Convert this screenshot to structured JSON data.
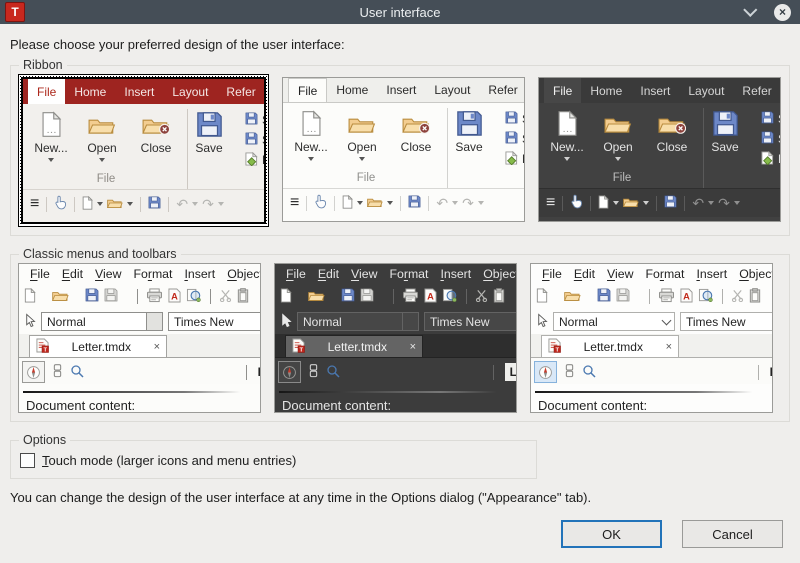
{
  "window": {
    "title": "User interface",
    "app_icon": "T",
    "controls": {
      "close": "×"
    }
  },
  "colors": {
    "titlebar": "#454e57",
    "dialog_bg": "#efeeec",
    "ribbon_red": "#9e2420",
    "ok_button_border": "#2273b9",
    "folder_icon": "#f3cd90",
    "floppy_icon": "#6d88c8"
  },
  "intro": "Please choose your preferred design of the user interface:",
  "selection": {
    "selected_preview": "ribbon-colorful"
  },
  "ribbon_group": {
    "label": "Ribbon"
  },
  "classic_group": {
    "label": "Classic menus and toolbars"
  },
  "options_group": {
    "label": "Options",
    "touch_mode": {
      "accel": "T",
      "rest": "ouch mode (larger icons and menu entries)",
      "checked": false
    }
  },
  "ribbon_preview": {
    "tabs": [
      "File",
      "Home",
      "Insert",
      "Layout",
      "Refer"
    ],
    "active_tab": "File",
    "big_buttons": [
      "New...",
      "Open",
      "Close",
      "Save"
    ],
    "small_buttons": [
      "Sa",
      "Sa",
      "EP"
    ],
    "group_label": "File"
  },
  "classic_preview": {
    "menus": [
      {
        "pre": "",
        "accel": "F",
        "post": "ile"
      },
      {
        "pre": "",
        "accel": "E",
        "post": "dit"
      },
      {
        "pre": "",
        "accel": "V",
        "post": "iew"
      },
      {
        "pre": "Fo",
        "accel": "r",
        "post": "mat"
      },
      {
        "pre": "",
        "accel": "I",
        "post": "nsert"
      },
      {
        "pre": "",
        "accel": "O",
        "post": "bject"
      }
    ],
    "style_combo": "Normal",
    "font_combo": "Times New",
    "doc_tab": "Letter.tmdx",
    "tab_close": "×",
    "ruler_fragment": "L",
    "content_text": "Document content:"
  },
  "icons": {
    "pdf_letter": "A",
    "doc_letter": "T"
  },
  "footer_note": "You can change the design of the user interface at any time in the Options dialog (\"Appearance\" tab).",
  "actions": {
    "ok": "OK",
    "cancel": "Cancel"
  }
}
